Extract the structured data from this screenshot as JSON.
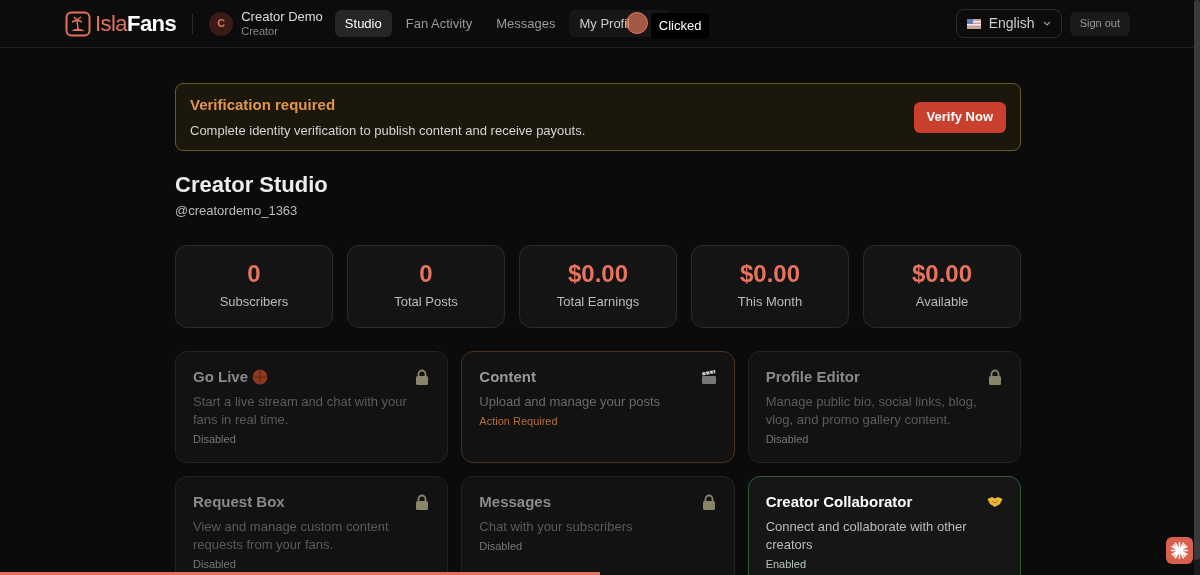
{
  "header": {
    "brand": {
      "part1": "Isla",
      "part2": "Fans"
    },
    "user": {
      "initial": "C",
      "name": "Creator Demo",
      "role": "Creator"
    },
    "nav": [
      {
        "label": "Studio",
        "selected": true
      },
      {
        "label": "Fan Activity",
        "selected": false
      },
      {
        "label": "Messages",
        "selected": false
      },
      {
        "label": "My Profil",
        "selected": false
      }
    ],
    "tooltip": "Clicked",
    "language": "English",
    "sign_out": "Sign out"
  },
  "banner": {
    "title": "Verification required",
    "text": "Complete identity verification to publish content and receive payouts.",
    "button": "Verify Now"
  },
  "page": {
    "title": "Creator Studio",
    "handle": "@creatordemo_1363"
  },
  "stats": [
    {
      "value": "0",
      "label": "Subscribers"
    },
    {
      "value": "0",
      "label": "Total Posts"
    },
    {
      "value": "$0.00",
      "label": "Total Earnings"
    },
    {
      "value": "$0.00",
      "label": "This Month"
    },
    {
      "value": "$0.00",
      "label": "Available"
    }
  ],
  "features": [
    {
      "title": "Go Live",
      "badge": true,
      "description": "Start a live stream and chat with your fans in real time.",
      "status": "Disabled",
      "kind": "disabled"
    },
    {
      "title": "Content",
      "badge": false,
      "description": "Upload and manage your posts",
      "status": "Action Required",
      "kind": "action"
    },
    {
      "title": "Profile Editor",
      "badge": false,
      "description": "Manage public bio, social links, blog, vlog, and promo gallery content.",
      "status": "Disabled",
      "kind": "disabled"
    },
    {
      "title": "Request Box",
      "badge": false,
      "description": "View and manage custom content requests from your fans.",
      "status": "Disabled",
      "kind": "disabled"
    },
    {
      "title": "Messages",
      "badge": false,
      "description": "Chat with your subscribers",
      "status": "Disabled",
      "kind": "disabled"
    },
    {
      "title": "Creator Collaborator",
      "badge": false,
      "description": "Connect and collaborate with other creators",
      "status": "Enabled",
      "kind": "enabled"
    }
  ],
  "progress": {
    "level": 0.5
  }
}
